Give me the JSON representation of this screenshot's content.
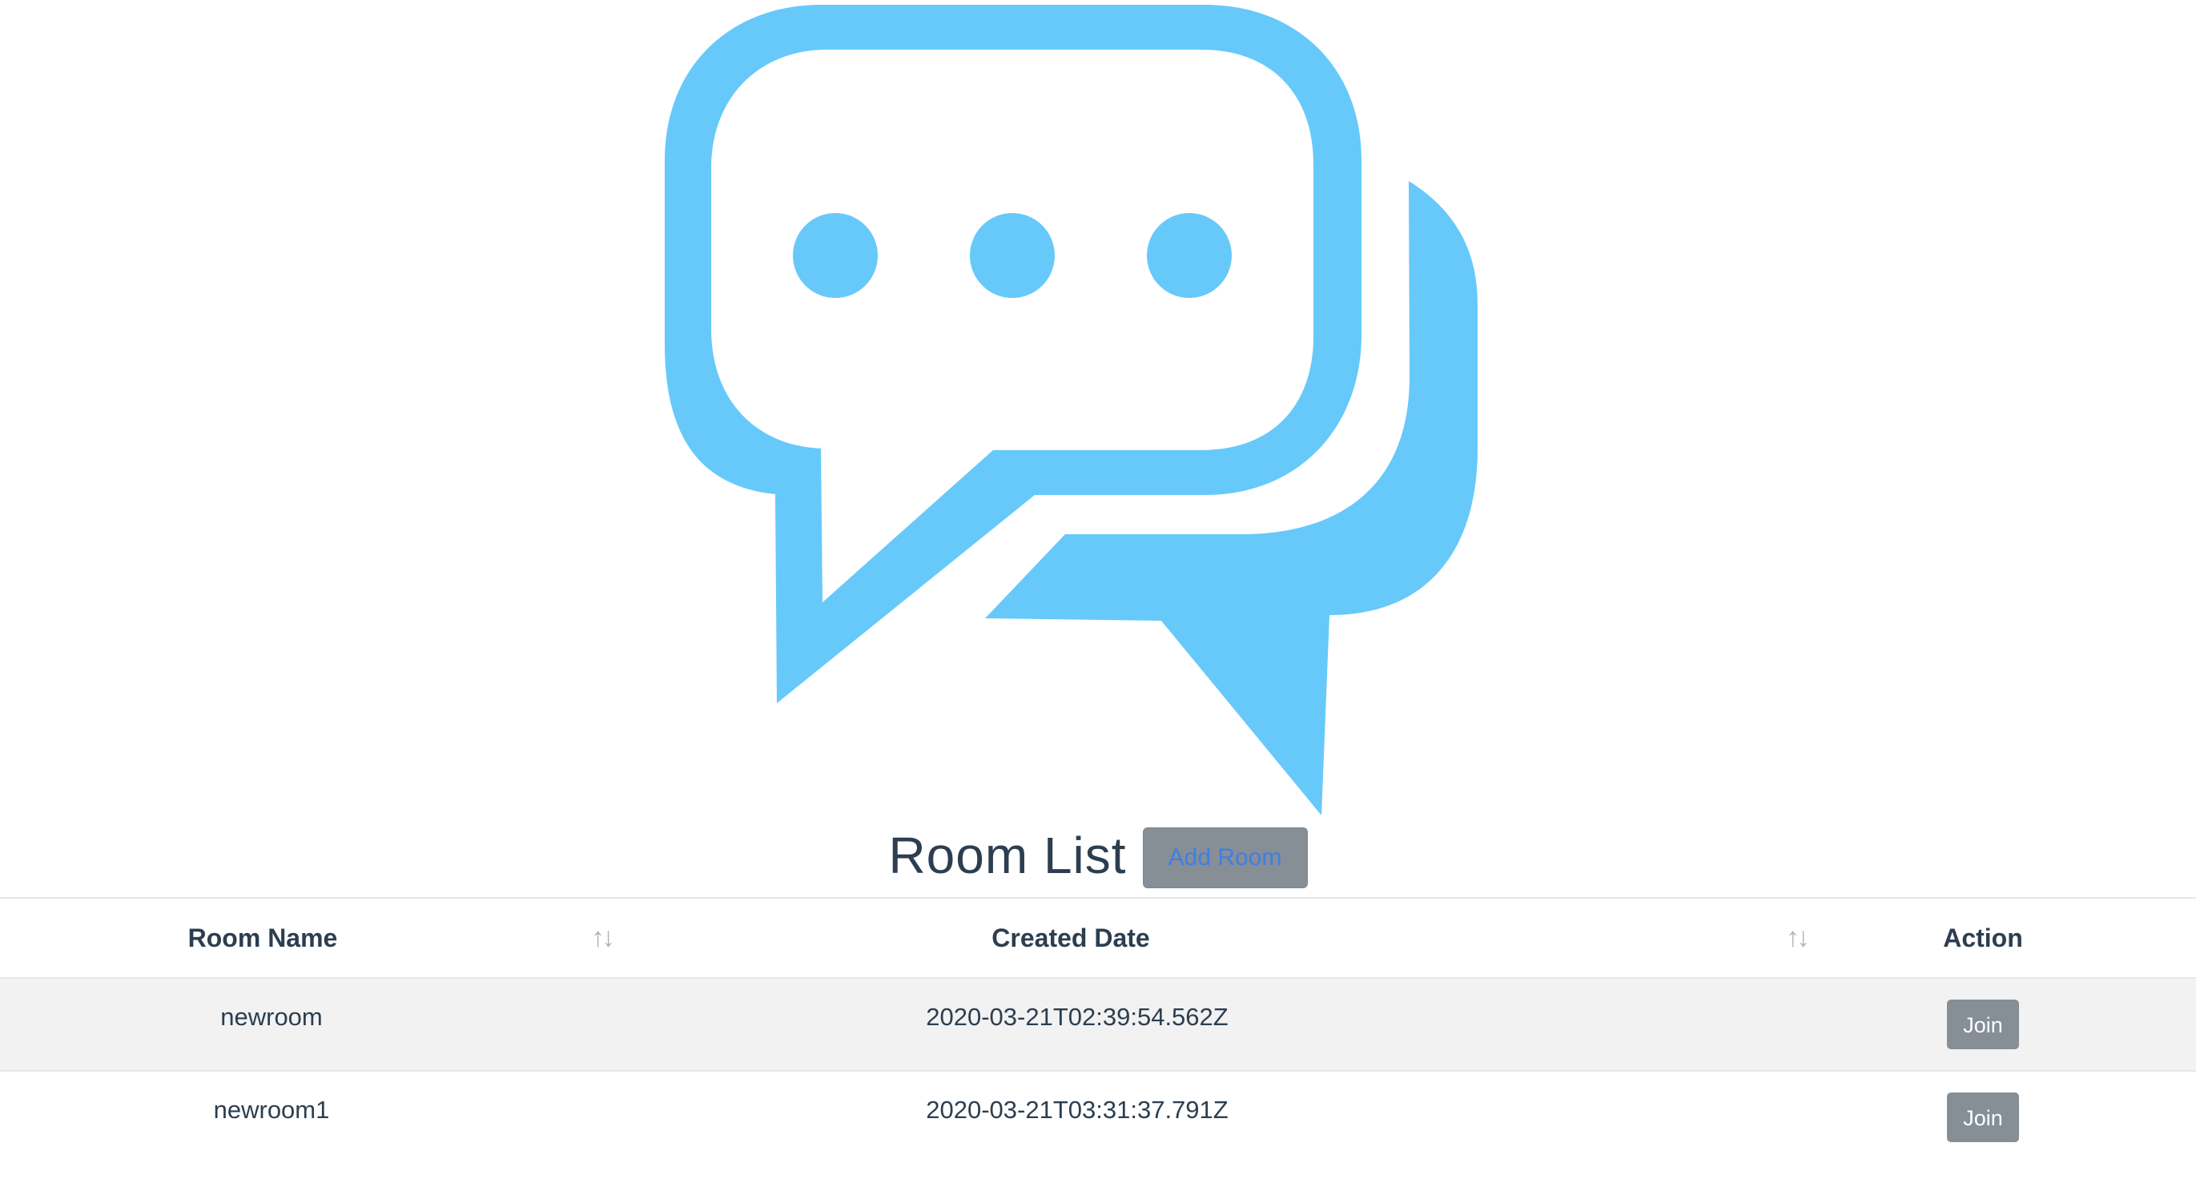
{
  "header": {
    "logo_icon": "chat-bubbles-logo",
    "logo_color": "#66c9fa",
    "title": "Room List",
    "add_room_label": "Add Room"
  },
  "table": {
    "columns": [
      {
        "label": "Room Name",
        "sortable": true,
        "sort_icon": "sort-arrows-icon"
      },
      {
        "label": "Created Date",
        "sortable": true,
        "sort_icon": "sort-arrows-icon"
      },
      {
        "label": "Action",
        "sortable": false
      }
    ],
    "rows": [
      {
        "room_name": "newroom",
        "created_date": "2020-03-21T02:39:54.562Z",
        "action_label": "Join"
      },
      {
        "room_name": "newroom1",
        "created_date": "2020-03-21T03:31:37.791Z",
        "action_label": "Join"
      }
    ]
  },
  "colors": {
    "button_bg": "#868e96",
    "add_room_text": "#3f7ee8",
    "striped_row": "#f2f2f2",
    "text": "#2c3e50"
  }
}
